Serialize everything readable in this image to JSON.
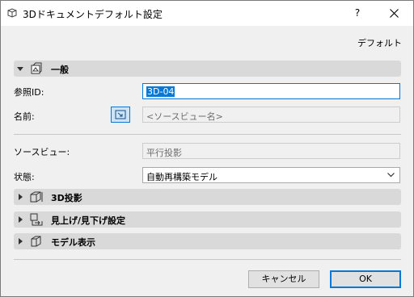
{
  "window": {
    "title": "3Dドキュメントデフォルト設定",
    "help_label": "?",
    "close_label": "×"
  },
  "defaults_link": "デフォルト",
  "sections": {
    "general": "一般",
    "projection": "3D投影",
    "lookup": "見上げ/見下げ設定",
    "model_display": "モデル表示"
  },
  "fields": {
    "ref_id_label": "参照ID:",
    "ref_id_value": "3D-04",
    "name_label": "名前:",
    "name_placeholder": "<ソースビュー名>",
    "source_view_label": "ソースビュー:",
    "source_view_value": "平行投影",
    "status_label": "状態:",
    "status_value": "自動再構築モデル"
  },
  "buttons": {
    "cancel": "キャンセル",
    "ok": "OK"
  }
}
